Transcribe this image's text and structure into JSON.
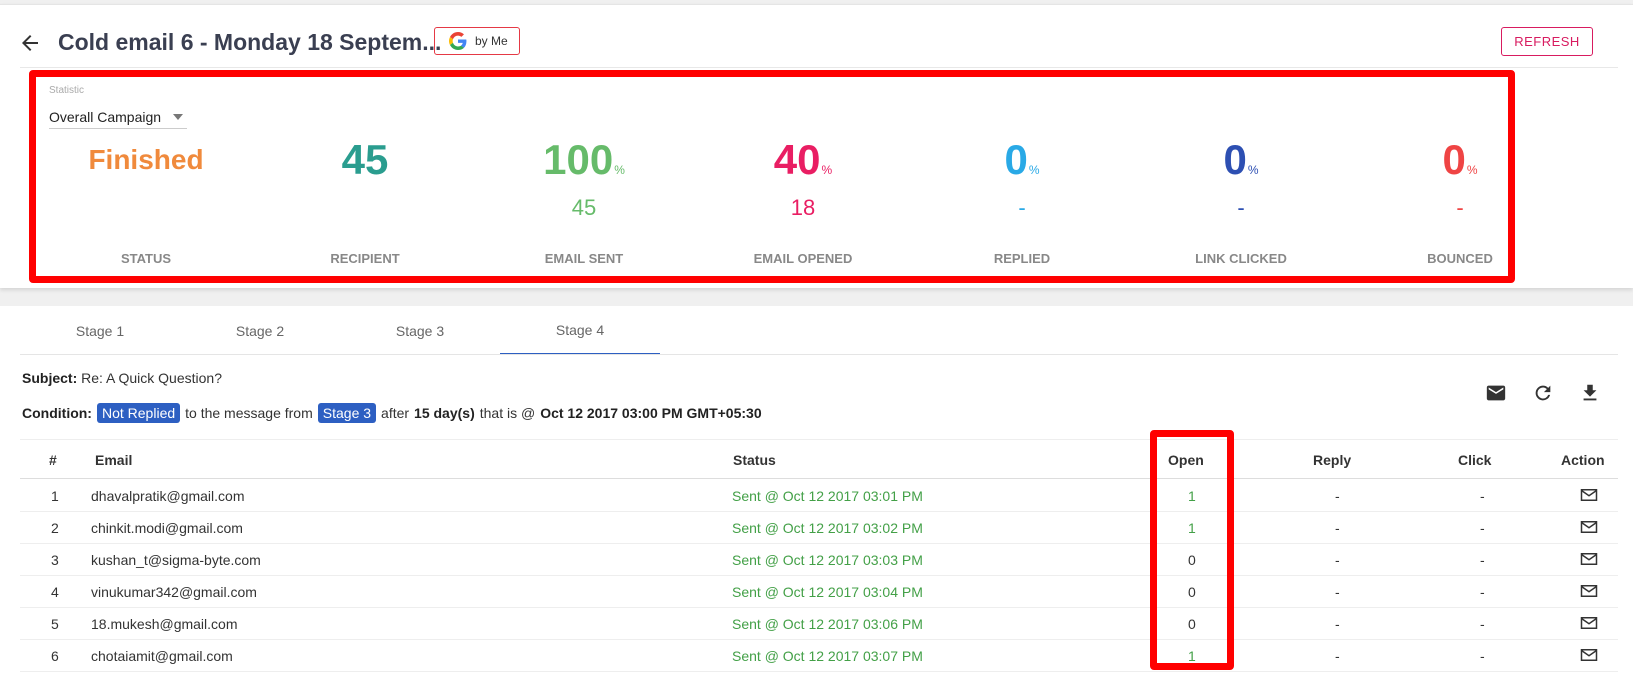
{
  "header": {
    "title": "Cold email 6 - Monday 18 Septem...",
    "byme_label": "by Me",
    "refresh_label": "REFRESH"
  },
  "statistic": {
    "label": "Statistic",
    "selected": "Overall Campaign",
    "columns": [
      {
        "value": "Finished",
        "sub": "",
        "name": "STATUS",
        "color": "#f08a3c"
      },
      {
        "value": "45",
        "sub": "",
        "name": "RECIPIENT",
        "color": "#2a9d8f"
      },
      {
        "value": "100",
        "pct": "%",
        "sub": "45",
        "name": "EMAIL SENT",
        "color": "#66bb6a"
      },
      {
        "value": "40",
        "pct": "%",
        "sub": "18",
        "name": "EMAIL OPENED",
        "color": "#e91e63"
      },
      {
        "value": "0",
        "pct": "%",
        "sub": "-",
        "name": "REPLIED",
        "color": "#29a9e6"
      },
      {
        "value": "0",
        "pct": "%",
        "sub": "-",
        "name": "LINK CLICKED",
        "color": "#2d4fb2"
      },
      {
        "value": "0",
        "pct": "%",
        "sub": "-",
        "name": "BOUNCED",
        "color": "#ef4444"
      }
    ]
  },
  "tabs": [
    "Stage 1",
    "Stage 2",
    "Stage 3",
    "Stage 4"
  ],
  "active_tab": "Stage 4",
  "subject": {
    "label": "Subject:",
    "value": "Re: A Quick Question?"
  },
  "condition": {
    "label": "Condition:",
    "chip1": "Not Replied",
    "text1": "to the message from",
    "chip2": "Stage 3",
    "text2": "after",
    "days": "15 day(s)",
    "text3": "that is @",
    "date": "Oct 12 2017 03:00 PM GMT+05:30"
  },
  "toolbar_icons": [
    "mail-icon",
    "refresh-icon",
    "download-icon"
  ],
  "table": {
    "headers": [
      "#",
      "Email",
      "Status",
      "Open",
      "Reply",
      "Click",
      "Action"
    ],
    "rows": [
      {
        "num": "1",
        "email": "dhavalpratik@gmail.com",
        "status": "Sent @ Oct 12 2017 03:01 PM",
        "open": "1",
        "reply": "-",
        "click": "-"
      },
      {
        "num": "2",
        "email": "chinkit.modi@gmail.com",
        "status": "Sent @ Oct 12 2017 03:02 PM",
        "open": "1",
        "reply": "-",
        "click": "-"
      },
      {
        "num": "3",
        "email": "kushan_t@sigma-byte.com",
        "status": "Sent @ Oct 12 2017 03:03 PM",
        "open": "0",
        "reply": "-",
        "click": "-"
      },
      {
        "num": "4",
        "email": "vinukumar342@gmail.com",
        "status": "Sent @ Oct 12 2017 03:04 PM",
        "open": "0",
        "reply": "-",
        "click": "-"
      },
      {
        "num": "5",
        "email": "18.mukesh@gmail.com",
        "status": "Sent @ Oct 12 2017 03:06 PM",
        "open": "0",
        "reply": "-",
        "click": "-"
      },
      {
        "num": "6",
        "email": "chotaiamit@gmail.com",
        "status": "Sent @ Oct 12 2017 03:07 PM",
        "open": "1",
        "reply": "-",
        "click": "-"
      }
    ]
  },
  "colors": {
    "accent": "#2d5fc2",
    "highlight": "#ff0000",
    "sent": "#43a047"
  }
}
